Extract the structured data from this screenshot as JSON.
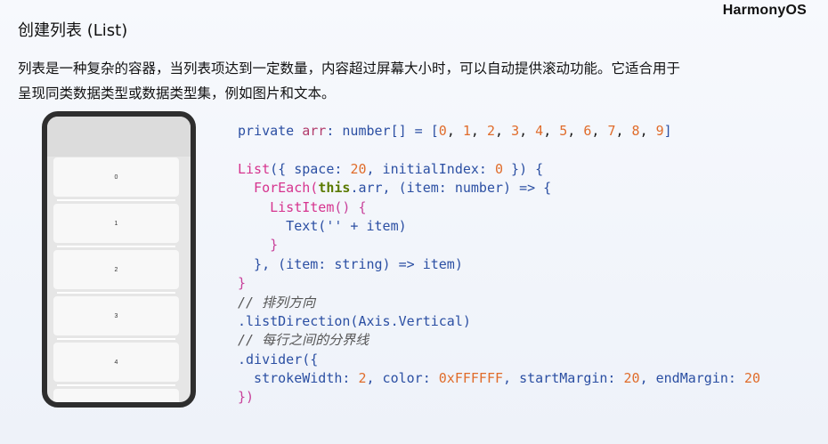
{
  "brand": "HarmonyOS",
  "title": "创建列表 (List)",
  "description": [
    "列表是一种复杂的容器，当列表项达到一定数量，内容超过屏幕大小时，可以自动提供滚动功能。它适合用于",
    "呈现同类数据类型或数据类型集，例如图片和文本。"
  ],
  "phone": {
    "items": [
      "0",
      "1",
      "2",
      "3",
      "4"
    ]
  },
  "code": {
    "l1": [
      "private ",
      "arr",
      ": number[] = [",
      "0",
      ", ",
      "1",
      ", ",
      "2",
      ", ",
      "3",
      ", ",
      "4",
      ", ",
      "5",
      ", ",
      "6",
      ", ",
      "7",
      ", ",
      "8",
      ", ",
      "9",
      "]"
    ],
    "l3a": "List",
    "l3b": "({ space: ",
    "l3c": "20",
    "l3d": ", initialIndex: ",
    "l3e": "0",
    "l3f": " }) {",
    "l4a": "  ForEach(",
    "l4b": "this",
    "l4c": ".arr, (item: number) => {",
    "l5a": "    ListItem",
    "l5b": "() {",
    "l6": "      Text('' + item)",
    "l7": "    }",
    "l8": "  }, (item: string) => item)",
    "l9": "}",
    "l10": "// 排列方向",
    "l11": ".listDirection(Axis.Vertical)",
    "l12": "// 每行之间的分界线",
    "l13": ".divider({",
    "l14a": "  strokeWidth: ",
    "l14b": "2",
    "l14c": ", color: ",
    "l14d": "0xFFFFFF",
    "l14e": ", startMargin: ",
    "l14f": "20",
    "l14g": ", endMargin: ",
    "l14h": "20",
    "l15": "})"
  }
}
